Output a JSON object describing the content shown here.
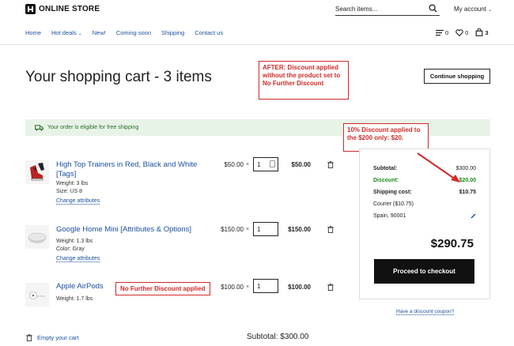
{
  "header": {
    "logo_text": "ONLINE STORE",
    "search_placeholder": "Search items...",
    "account_label": "My account"
  },
  "nav": {
    "items": [
      "Home",
      "Hot deals",
      "New!",
      "Coming soon",
      "Shipping",
      "Contact us"
    ],
    "compare_count": "0",
    "wishlist_count": "0",
    "cart_count": "3"
  },
  "page": {
    "title": "Your shopping cart - 3 items",
    "continue_label": "Continue shopping",
    "free_shipping": "Your order is eligible for free shipping"
  },
  "notes": {
    "after": "AFTER: Discount applied without the product set to No Further Discount",
    "ten_percent": "10% Discount applied to the $200 only: $20.",
    "no_further": "No Further Discount applied"
  },
  "items": [
    {
      "name": "High Top Trainers in Red, Black and White [Tags]",
      "attrs": [
        "Weight: 3 lbs",
        "Size: US 8"
      ],
      "change_label": "Change attributes",
      "price": "$50.00",
      "qty": "1",
      "total": "$50.00"
    },
    {
      "name": "Google Home Mini [Attributes & Options]",
      "attrs": [
        "Weight: 1.3 lbs",
        "Color: Gray"
      ],
      "change_label": "Change attributes",
      "price": "$150.00",
      "qty": "1",
      "total": "$150.00"
    },
    {
      "name": "Apple AirPods",
      "attrs": [
        "Weight: 1.7 lbs"
      ],
      "price": "$100.00",
      "qty": "1",
      "total": "$100.00"
    }
  ],
  "times_symbol": "×",
  "summary": {
    "subtotal_label": "Subtotal:",
    "subtotal_value": "$300.00",
    "discount_label": "Discount:",
    "discount_value": "$20.00",
    "shipping_label": "Shipping cost:",
    "shipping_value": "$10.75",
    "courier": "Courier ($10.75)",
    "location": "Spain, 90001",
    "grand_total": "$290.75",
    "checkout_label": "Proceed to checkout",
    "coupon_label": "Have a discount coupon?"
  },
  "footer": {
    "empty_label": "Empty your cart",
    "subtotal_text": "Subtotal: $300.00"
  },
  "colors": {
    "annotation_red": "#d12a2a",
    "link_blue": "#1a4f9c",
    "discount_green": "#1a8a1a",
    "shipping_bg": "#e8f3e8"
  }
}
